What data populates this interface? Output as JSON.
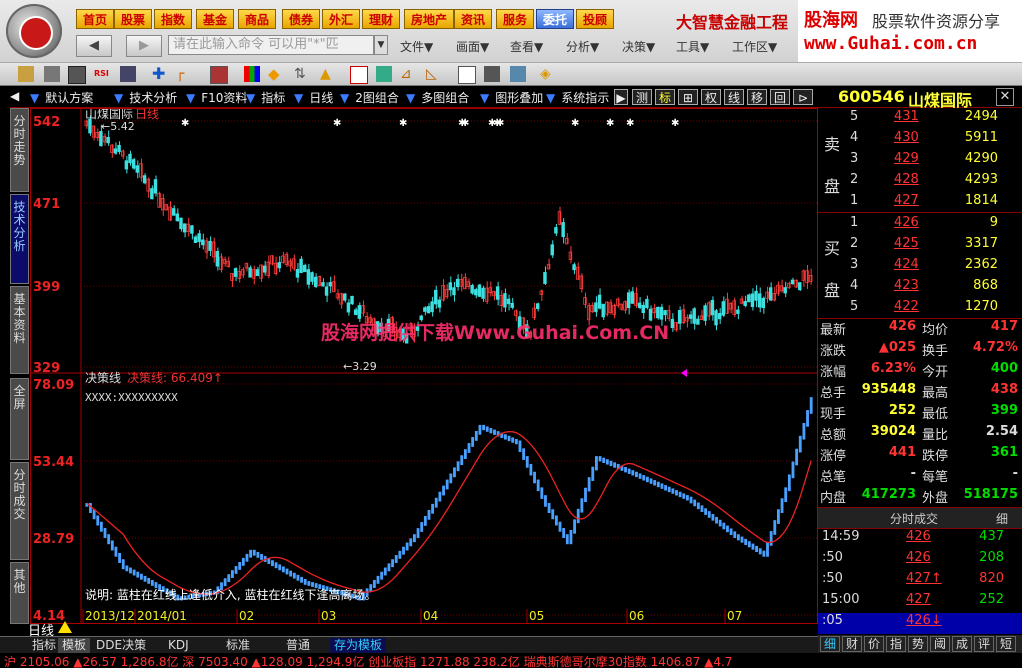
{
  "nav": {
    "buttons": [
      "首页",
      "股票",
      "指数",
      "基金",
      "商品",
      "债券",
      "外汇",
      "理财",
      "房地产",
      "资讯",
      "服务",
      "委托",
      "投顾"
    ],
    "brand": "大智慧金融工程"
  },
  "ad": {
    "line1": "股海网",
    "line1b": "股票软件资源分享",
    "line2": "www.Guhai.com.cn"
  },
  "cmd": {
    "placeholder": "请在此输入命令  可以用\"*\"匹"
  },
  "menu": [
    "文件▼",
    "画面▼",
    "查看▼",
    "分析▼",
    "决策▼",
    "工具▼",
    "工作区▼"
  ],
  "bar2": {
    "items": [
      "默认方案",
      "技术分析",
      "F10资料",
      "指标",
      "日线",
      "2图组合",
      "多图组合",
      "图形叠加",
      "系统指示"
    ],
    "right": [
      "测",
      "标",
      "⊞",
      "权",
      "线",
      "移",
      "回",
      "⊳"
    ]
  },
  "lefttabs": [
    "分时走势",
    "技术分析",
    "基本资料",
    "全屏",
    "分时成交",
    "其他"
  ],
  "stock": {
    "code": "600546",
    "name": "山煤国际"
  },
  "kpanel": {
    "title": "山煤国际",
    "period": "日线",
    "maxlabel": "5.42",
    "minlabel": "3.29",
    "axis": [
      "542",
      "471",
      "399",
      "329"
    ],
    "watermark": "股海网提供下载Www.Guhai.Com.CN"
  },
  "ipanel": {
    "name": "决策线",
    "label": "决策线: 66.409↑",
    "subline": "XXXX:XXXXXXXXX",
    "axis": [
      "78.09",
      "53.44",
      "28.79",
      "4.14"
    ],
    "note": "说明: 蓝柱在红线上逢低介入, 蓝柱在红线下逢高离场。"
  },
  "xaxis": {
    "left": "日线",
    "labels": [
      "2013/12",
      "2014/01",
      "02",
      "03",
      "04",
      "05",
      "06",
      "07"
    ]
  },
  "sell": [
    {
      "n": "5",
      "p": "431",
      "v": "2494"
    },
    {
      "n": "4",
      "p": "430",
      "v": "5911"
    },
    {
      "n": "3",
      "p": "429",
      "v": "4290"
    },
    {
      "n": "2",
      "p": "428",
      "v": "4293"
    },
    {
      "n": "1",
      "p": "427",
      "v": "1814"
    }
  ],
  "buy": [
    {
      "n": "1",
      "p": "426",
      "v": "9"
    },
    {
      "n": "2",
      "p": "425",
      "v": "3317"
    },
    {
      "n": "3",
      "p": "424",
      "v": "2362"
    },
    {
      "n": "4",
      "p": "423",
      "v": "868"
    },
    {
      "n": "5",
      "p": "422",
      "v": "1270"
    }
  ],
  "sell_label": [
    "卖",
    "盘"
  ],
  "buy_label": [
    "买",
    "盘"
  ],
  "quote": [
    {
      "k1": "最新",
      "v1": "426",
      "k2": "均价",
      "v2": "417"
    },
    {
      "k1": "涨跌",
      "v1": "▲025",
      "k2": "换手",
      "v2": "4.72%"
    },
    {
      "k1": "涨幅",
      "v1": "6.23%",
      "k2": "今开",
      "v2": "400"
    },
    {
      "k1": "总手",
      "v1": "935448",
      "k2": "最高",
      "v2": "438"
    },
    {
      "k1": "现手",
      "v1": "252",
      "k2": "最低",
      "v2": "399"
    },
    {
      "k1": "总额",
      "v1": "39024",
      "k2": "量比",
      "v2": "2.54"
    },
    {
      "k1": "涨停",
      "v1": "441",
      "k2": "跌停",
      "v2": "361"
    },
    {
      "k1": "总笔",
      "v1": "-",
      "k2": "每笔",
      "v2": "-"
    },
    {
      "k1": "内盘",
      "v1": "417273",
      "k2": "外盘",
      "v2": "518175"
    }
  ],
  "ticks": {
    "header": "分时成交",
    "tab": "细",
    "rows": [
      {
        "t": "14:59",
        "p": "426",
        "v": "437"
      },
      {
        "t": ":50",
        "p": "426",
        "v": "208"
      },
      {
        "t": ":50",
        "p": "427↑",
        "v": "820"
      },
      {
        "t": "15:00",
        "p": "427",
        "v": "252"
      },
      {
        "t": ":05",
        "p": "426↓",
        "v": ""
      }
    ]
  },
  "rtabs": [
    "细",
    "财",
    "价",
    "指",
    "势",
    "阈",
    "成",
    "评",
    "短"
  ],
  "btabs": [
    "指标",
    "模板",
    "DDE决策",
    "KDJ",
    "标准",
    "普通",
    "存为模板"
  ],
  "ticker": "沪 2105.06 ▲26.57 1,286.8亿 深 7503.40 ▲128.09 1,294.9亿 创业板指 1271.88 238.2亿 瑞典斯德哥尔摩30指数 1406.87 ▲4.7"
}
